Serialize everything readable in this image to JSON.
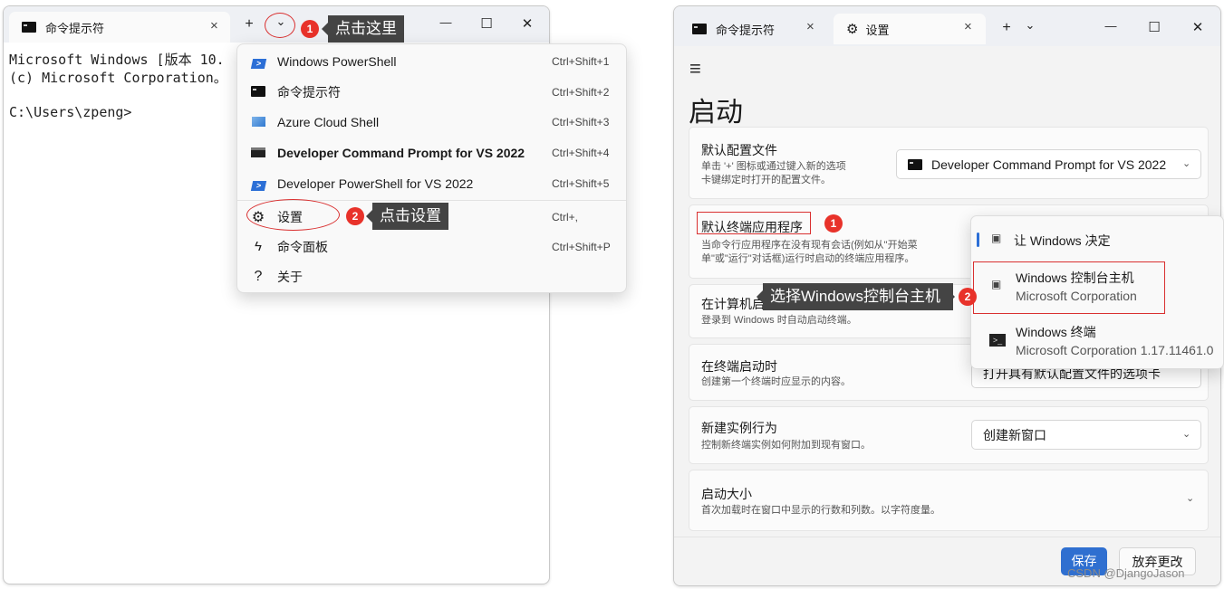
{
  "left_window": {
    "tab_title": "命令提示符",
    "close_tab": "×",
    "new_tab": "+",
    "dropdown_arrow": "⌄",
    "minimize": "—",
    "maximize": "☐",
    "close": "✕",
    "terminal_lines": [
      "Microsoft Windows [版本 10.",
      "(c) Microsoft Corporation。",
      "",
      "C:\\Users\\zpeng>"
    ],
    "menu": [
      {
        "label": "Windows PowerShell",
        "shortcut": "Ctrl+Shift+1",
        "icon": "powershell-icon"
      },
      {
        "label": "命令提示符",
        "shortcut": "Ctrl+Shift+2",
        "icon": "cmd-icon"
      },
      {
        "label": "Azure Cloud Shell",
        "shortcut": "Ctrl+Shift+3",
        "icon": "azure-icon"
      },
      {
        "label": "Developer Command Prompt for VS 2022",
        "shortcut": "Ctrl+Shift+4",
        "icon": "dev-cmd-icon"
      },
      {
        "label": "Developer PowerShell for VS 2022",
        "shortcut": "Ctrl+Shift+5",
        "icon": "dev-powershell-icon"
      },
      {
        "label": "设置",
        "shortcut": "Ctrl+,",
        "icon": "gear-icon"
      },
      {
        "label": "命令面板",
        "shortcut": "Ctrl+Shift+P",
        "icon": "lightning-icon"
      },
      {
        "label": "关于",
        "shortcut": "",
        "icon": "question-icon"
      }
    ],
    "callout1_num": "1",
    "callout1_text": "点击这里",
    "callout2_num": "2",
    "callout2_text": "点击设置"
  },
  "right_window": {
    "tab1_title": "命令提示符",
    "tab2_title": "设置",
    "close_tab": "×",
    "new_tab": "+",
    "dropdown_arrow": "⌄",
    "minimize": "—",
    "maximize": "☐",
    "close": "✕",
    "hamburger": "≡",
    "page_title": "启动",
    "settings": [
      {
        "title": "默认配置文件",
        "desc": [
          "单击 '+' 图标或通过键入新的选项",
          "卡键绑定时打开的配置文件。"
        ],
        "value": "Developer Command Prompt for VS 2022"
      },
      {
        "title": "默认终端应用程序",
        "desc": [
          "当命令行应用程序在没有现有会话(例如从\"开始菜",
          "单\"或\"运行\"对话框)运行时启动的终端应用程序。"
        ],
        "value": ""
      },
      {
        "title": "在计算机启动时启动",
        "desc": [
          "登录到 Windows 时自动启动终端。"
        ],
        "value": ""
      },
      {
        "title": "在终端启动时",
        "desc": [
          "创建第一个终端时应显示的内容。"
        ],
        "value": "打开具有默认配置文件的选项卡"
      },
      {
        "title": "新建实例行为",
        "desc": [
          "控制新终端实例如何附加到现有窗口。"
        ],
        "value": "创建新窗口"
      },
      {
        "title": "启动大小",
        "desc": [
          "首次加载时在窗口中显示的行数和列数。以字符度量。"
        ],
        "value": ""
      }
    ],
    "popup": [
      {
        "title": "让 Windows 决定",
        "sub": ""
      },
      {
        "title": "Windows 控制台主机",
        "sub": "Microsoft Corporation"
      },
      {
        "title": "Windows 终端",
        "sub": "Microsoft Corporation 1.17.11461.0"
      }
    ],
    "callout1_num": "1",
    "callout2_num": "2",
    "callout2_text": "选择Windows控制台主机",
    "save_label": "保存",
    "discard_label": "放弃更改",
    "watermark": "CSDN @DjangoJason"
  },
  "colors": {
    "accent": "#2c6fd6",
    "callout_red": "#e8322a",
    "tooltip_bg": "#444444"
  }
}
